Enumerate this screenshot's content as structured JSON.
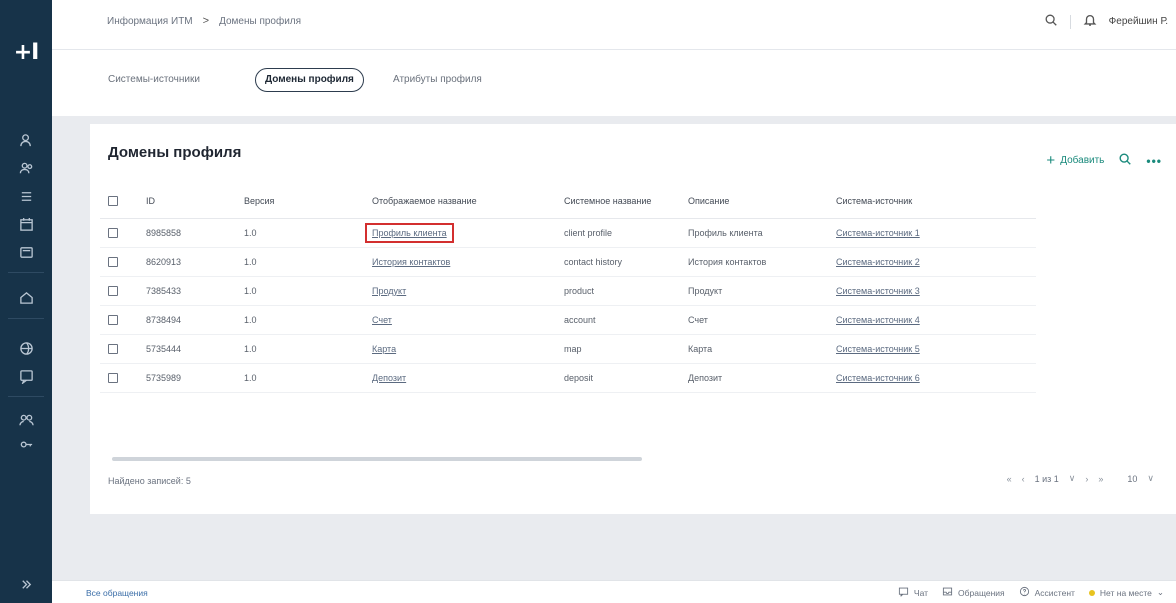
{
  "app": {
    "logo": "+I"
  },
  "breadcrumbs": [
    "Информация ИТМ",
    "Домены профиля"
  ],
  "breadcrumb_sep": ">",
  "user": {
    "name": "Ферейшин Р."
  },
  "tabs": [
    {
      "label": "Системы-источники",
      "active": false
    },
    {
      "label": "Домены профиля",
      "active": true
    },
    {
      "label": "Атрибуты профиля",
      "active": false
    }
  ],
  "page": {
    "title": "Домены профиля",
    "add_label": "Добавить"
  },
  "table": {
    "columns": [
      "ID",
      "Версия",
      "Отображаемое название",
      "Системное название",
      "Описание",
      "Система-источник"
    ],
    "rows": [
      {
        "id": "8985858",
        "version": "1.0",
        "display": "Профиль клиента",
        "system": "client profile",
        "description": "Профиль клиента",
        "source": "Система-источник 1"
      },
      {
        "id": "8620913",
        "version": "1.0",
        "display": "История контактов",
        "system": "contact history",
        "description": "История контактов",
        "source": "Система-источник 2"
      },
      {
        "id": "7385433",
        "version": "1.0",
        "display": "Продукт",
        "system": "product",
        "description": "Продукт",
        "source": "Система-источник 3"
      },
      {
        "id": "8738494",
        "version": "1.0",
        "display": "Счет",
        "system": "account",
        "description": "Счет",
        "source": "Система-источник 4"
      },
      {
        "id": "5735444",
        "version": "1.0",
        "display": "Карта",
        "system": "map",
        "description": "Карта",
        "source": "Система-источник 5"
      },
      {
        "id": "5735989",
        "version": "1.0",
        "display": "Депозит",
        "system": "deposit",
        "description": "Депозит",
        "source": "Система-источник 6"
      }
    ]
  },
  "footer": {
    "found_label": "Найдено записей:",
    "found_count": "5"
  },
  "pager": {
    "first": "«",
    "prev": "‹",
    "page": "1 из 1",
    "next": "›",
    "last": "»",
    "per_page": "10"
  },
  "bottombar": {
    "left": "Все обращения",
    "items": [
      "Чат",
      "Обращения",
      "Ассистент",
      "Нет на месте"
    ]
  },
  "colors": {
    "accent": "#1a8a7c",
    "rail": "#173349",
    "highlight": "#d32f2f",
    "status": "#e8c31f"
  }
}
